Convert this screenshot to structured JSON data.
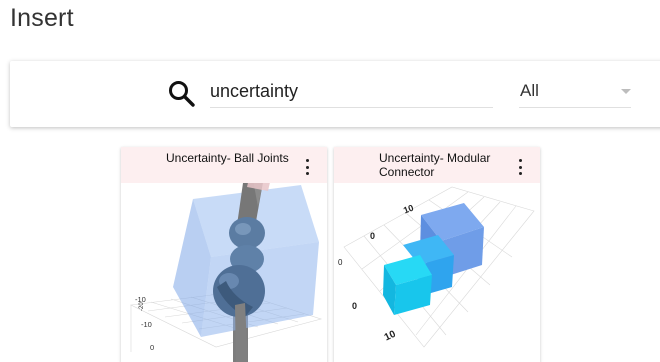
{
  "page": {
    "title": "Insert"
  },
  "search": {
    "icon": "search-icon",
    "query": "uncertainty",
    "filter_selected": "All"
  },
  "results": [
    {
      "title": "Uncertainty- Ball Joints",
      "menu_icon": "more-vertical-icon",
      "axis_labels": [
        "-10",
        "-20",
        "-10",
        "0"
      ]
    },
    {
      "title": "Uncertainty- Modular Connector",
      "menu_icon": "more-vertical-icon",
      "axis_labels": [
        "20",
        "10",
        "0",
        "0",
        "0",
        "10"
      ]
    }
  ],
  "colors": {
    "card_header_bg": "#fdeff0",
    "box_blue": "#8fb4ec",
    "joint_steel": "#5f7fa3",
    "connector_cyan": "#19d3f2"
  }
}
